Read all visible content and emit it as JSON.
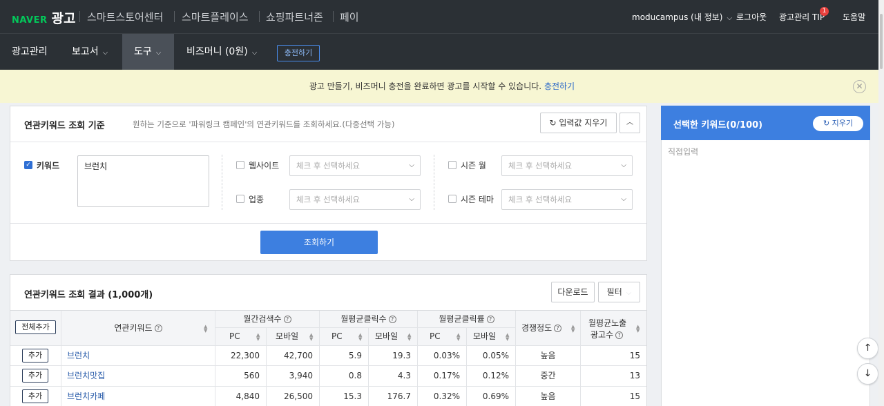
{
  "topbar": {
    "brand_naver": "NAVER",
    "brand_ad": "광고",
    "services": [
      "스마트스토어센터",
      "스마트플레이스",
      "쇼핑파트너존",
      "페이"
    ],
    "user": "moducampus (내 정보)",
    "logout": "로그아웃",
    "tip": "광고관리 TIP",
    "tip_badge": "1",
    "help": "도움말"
  },
  "nav": {
    "items": [
      "광고관리",
      "보고서",
      "도구",
      "비즈머니 (0원)"
    ],
    "charge": "충전하기"
  },
  "notice": {
    "text": "광고 만들기, 비즈머니 충전을 완료하면 광고를 시작할 수 있습니다.",
    "link": "충전하기"
  },
  "criteria": {
    "title": "연관키워드 조회 기준",
    "desc": "원하는 기준으로 '파워링크 캠페인'의 연관키워드를 조회하세요.(다중선택 가능)",
    "reset": "입력값 지우기",
    "keyword_label": "키워드",
    "keyword_value": "브런치",
    "website_label": "웹사이트",
    "industry_label": "업종",
    "season_month_label": "시즌 월",
    "season_theme_label": "시즌 테마",
    "select_placeholder": "체크 후 선택하세요",
    "search": "조회하기"
  },
  "results": {
    "title": "연관키워드 조회 결과 (1,000개)",
    "download": "다운로드",
    "filter": "필터",
    "add_all": "전체추가",
    "headers": {
      "keyword": "연관키워드",
      "monthly_search": "월간검색수",
      "avg_clicks": "월평균클릭수",
      "avg_ctr": "월평균클릭률",
      "competition": "경쟁정도",
      "avg_ads_1": "월평균노출",
      "avg_ads_2": "광고수",
      "pc": "PC",
      "mobile": "모바일"
    },
    "add_label": "추가",
    "rows": [
      {
        "keyword": "브런치",
        "search_pc": "22,300",
        "search_mobile": "42,700",
        "clicks_pc": "5.9",
        "clicks_mobile": "19.3",
        "ctr_pc": "0.03%",
        "ctr_mobile": "0.05%",
        "competition": "높음",
        "ads": "15"
      },
      {
        "keyword": "브런치맛집",
        "search_pc": "560",
        "search_mobile": "3,940",
        "clicks_pc": "0.8",
        "clicks_mobile": "4.3",
        "ctr_pc": "0.17%",
        "ctr_mobile": "0.12%",
        "competition": "중간",
        "ads": "13"
      },
      {
        "keyword": "브런치카페",
        "search_pc": "4,840",
        "search_mobile": "26,500",
        "clicks_pc": "15.3",
        "clicks_mobile": "176.7",
        "ctr_pc": "0.32%",
        "ctr_mobile": "0.69%",
        "competition": "높음",
        "ads": "15"
      }
    ]
  },
  "selected": {
    "title": "선택한 키워드(0/100)",
    "clear": "지우기",
    "direct_input": "직접입력"
  },
  "colors": {
    "header_bg": "#2b3035",
    "accent": "#3d7fe0",
    "notice_bg": "#f7f6d3",
    "naver_green": "#03c75a"
  }
}
